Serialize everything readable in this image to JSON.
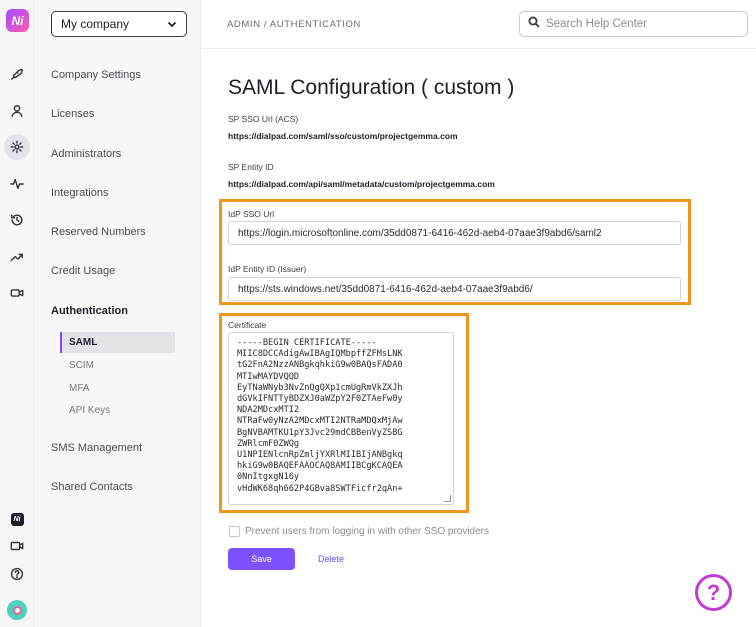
{
  "app": {
    "logo_text": "Ni",
    "rail_icons": [
      "rocket-icon",
      "user-icon",
      "gear-icon",
      "activity-icon",
      "history-icon",
      "trending-icon",
      "video-camera-icon"
    ],
    "rail_bottom_icons": [
      "dialpad-logo-icon",
      "video-icon",
      "help-circle-icon",
      "avatar"
    ]
  },
  "sidebar": {
    "company_select": "My company",
    "items": [
      {
        "label": "Company Settings"
      },
      {
        "label": "Licenses"
      },
      {
        "label": "Administrators"
      },
      {
        "label": "Integrations"
      },
      {
        "label": "Reserved Numbers"
      },
      {
        "label": "Credit Usage"
      },
      {
        "label": "Authentication"
      },
      {
        "label": "SMS Management"
      },
      {
        "label": "Shared Contacts"
      }
    ],
    "sub_items": [
      {
        "label": "SAML",
        "active": true
      },
      {
        "label": "SCIM"
      },
      {
        "label": "MFA"
      },
      {
        "label": "API Keys"
      }
    ]
  },
  "header": {
    "breadcrumb": "ADMIN / AUTHENTICATION",
    "search_placeholder": "Search Help Center"
  },
  "main": {
    "title": "SAML Configuration ( custom )",
    "sp_sso_url_label": "SP SSO Url (ACS)",
    "sp_sso_url_value": "https://dialpad.com/saml/sso/custom/projectgemma.com",
    "sp_entity_label": "SP Entity ID",
    "sp_entity_value": "https://dialpad.com/api/saml/metadata/custom/projectgemma.com",
    "idp_sso_label": "IdP SSO Url",
    "idp_sso_value": "https://login.microsoftonline.com/35dd0871-6416-462d-aeb4-07aae3f9abd6/saml2",
    "idp_entity_label": "IdP Entity ID (Issuer)",
    "idp_entity_value": "https://sts.windows.net/35dd0871-6416-462d-aeb4-07aae3f9abd6/",
    "certificate_label": "Certificate",
    "certificate_value": "-----BEGIN CERTIFICATE-----\nMIIC8DCCAdigAwIBAgIQMbpffZFMsLNK\ntG2FnA2NzzANBgkqhkiG9w0BAQsFADA0\nMTIwMAYDVQQD\nEyTNaWNyb3NvZnQgQXp1cmUgRmVkZXJh\ndGVkIFNTTyBDZXJ0aWZpY2F0ZTAeFw0y\nNDA2MDcxMTI2\nNTRaFw0yNzA2MDcxMTI2NTRaMDQxMjAw\nBgNVBAMTKU1pY3Jvc29mdCBBenVyZSBG\nZWRlcmF0ZWQg\nU1NPIENlcnRpZmljYXRlMIIBIjANBgkq\nhkiG9w0BAQEFAAOCAQ8AMIIBCgKCAQEA\n0NnItgxgN16y\nvHdWK68qh662P4GBva8SWTFicfr2qAn+",
    "prevent_label": "Prevent users from logging in with other SSO providers",
    "save_label": "Save",
    "delete_label": "Delete"
  },
  "colors": {
    "accent": "#7c52ff",
    "highlight": "#f0951d",
    "help": "#c23bd4"
  }
}
